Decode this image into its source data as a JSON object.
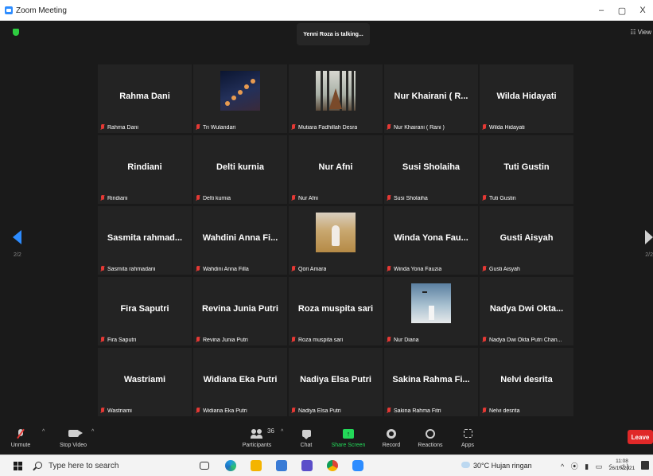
{
  "window": {
    "title": "Zoom Meeting",
    "controls": [
      "–",
      "▢",
      "X"
    ]
  },
  "meeting": {
    "talking_indicator": "Yenni Roza is talking...",
    "view_label": "☷ View",
    "page_left": "2/2",
    "page_right": "2/2",
    "participants": [
      {
        "display": "Rahma Dani",
        "label": "Rahma Dani",
        "photo": ""
      },
      {
        "display": "",
        "label": "Tri Wulandari",
        "photo": "moon"
      },
      {
        "display": "",
        "label": "Mutiara Fadhillah Desra",
        "photo": "forest"
      },
      {
        "display": "Nur Khairani ( R...",
        "label": "Nur Khairani ( Rani )",
        "photo": ""
      },
      {
        "display": "Wilda Hidayati",
        "label": "Wilda Hidayati",
        "photo": ""
      },
      {
        "display": "Rindiani",
        "label": "Rindiani",
        "photo": ""
      },
      {
        "display": "Delti kurnia",
        "label": "Delti kurnia",
        "photo": ""
      },
      {
        "display": "Nur Afni",
        "label": "Nur Afni",
        "photo": ""
      },
      {
        "display": "Susi Sholaiha",
        "label": "Susi Sholaiha",
        "photo": ""
      },
      {
        "display": "Tuti Gustin",
        "label": "Tuti Gustin",
        "photo": ""
      },
      {
        "display": "Sasmita rahmad...",
        "label": "Sasmita rahmadani",
        "photo": ""
      },
      {
        "display": "Wahdini Anna Fi...",
        "label": "Wahdini Anna Filla",
        "photo": ""
      },
      {
        "display": "",
        "label": "Qori Amara",
        "photo": "field"
      },
      {
        "display": "Winda Yona Fau...",
        "label": "Winda Yona Fauzia",
        "photo": ""
      },
      {
        "display": "Gusti Aisyah",
        "label": "Gusti Aisyah",
        "photo": ""
      },
      {
        "display": "Fira Saputri",
        "label": "Fira Saputri",
        "photo": ""
      },
      {
        "display": "Revina Junia Putri",
        "label": "Revina Junia Putri",
        "photo": ""
      },
      {
        "display": "Roza muspita sari",
        "label": "Roza muspita sari",
        "photo": ""
      },
      {
        "display": "",
        "label": "Nur Diana",
        "photo": "sky"
      },
      {
        "display": "Nadya Dwi Okta...",
        "label": "Nadya Dwi Okta Putri Chan...",
        "photo": ""
      },
      {
        "display": "Wastriami",
        "label": "Wastriami",
        "photo": ""
      },
      {
        "display": "Widiana Eka Putri",
        "label": "Widiana Eka Putri",
        "photo": ""
      },
      {
        "display": "Nadiya Elsa Putri",
        "label": "Nadiya Elsa Putri",
        "photo": ""
      },
      {
        "display": "Sakina Rahma Fi...",
        "label": "Sakina Rahma Fitri",
        "photo": ""
      },
      {
        "display": "Nelvi desrita",
        "label": "Nelvi desrita",
        "photo": ""
      }
    ]
  },
  "toolbar": {
    "unmute": "Unmute",
    "stop_video": "Stop Video",
    "participants": "Participants",
    "participant_count": "36",
    "chat": "Chat",
    "share_screen": "Share Screen",
    "record": "Record",
    "reactions": "Reactions",
    "apps": "Apps",
    "leave": "Leave",
    "caret": "^"
  },
  "taskbar": {
    "search_placeholder": "Type here to search",
    "weather": "30°C  Hujan ringan",
    "tray": "^ ⦿ ▮ ▭ ◜ ◁)",
    "time": "11:08",
    "date": "26/10/2021"
  },
  "colors": {
    "zoom_blue": "#2d8cff",
    "leave_red": "#e02828",
    "share_green": "#23d959",
    "muted_red": "#e53935"
  }
}
